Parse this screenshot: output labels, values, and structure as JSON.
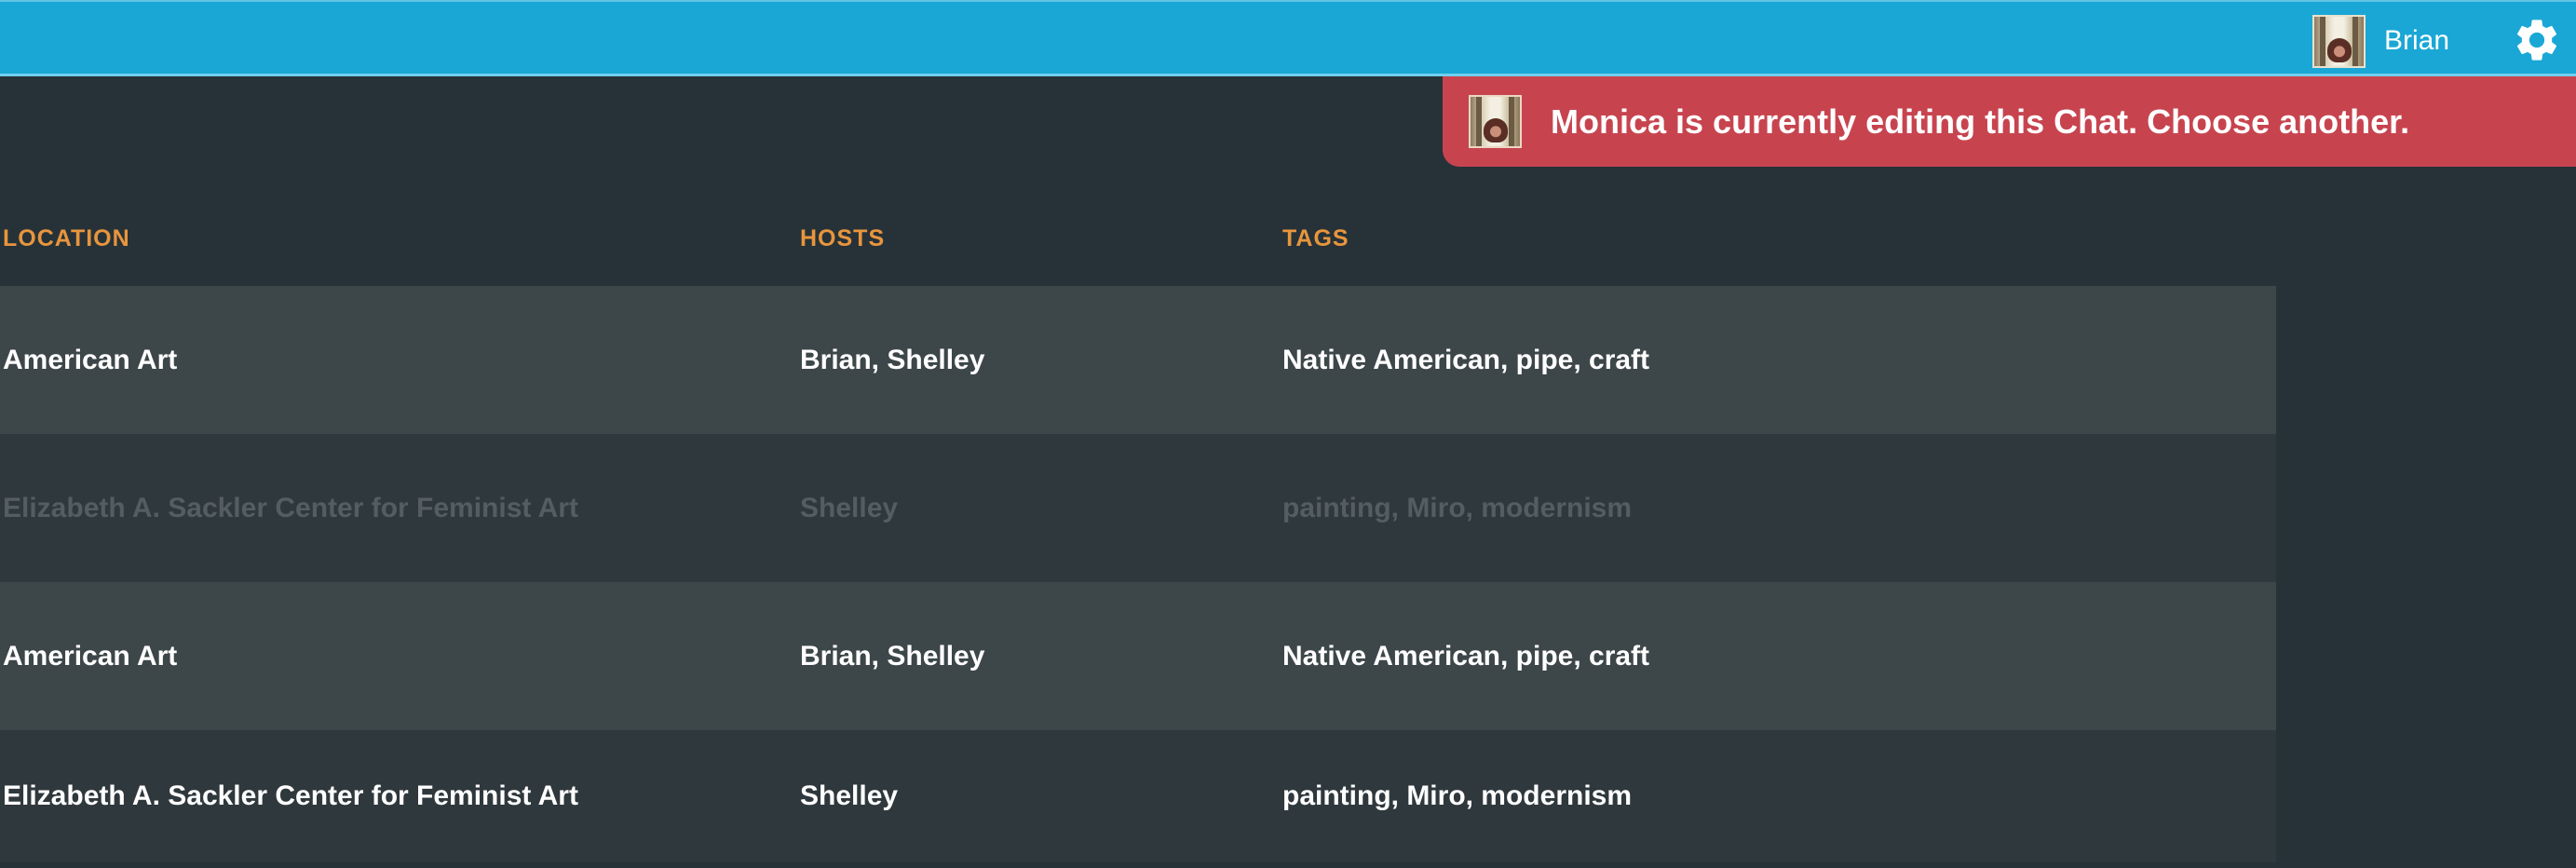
{
  "header": {
    "user_name": "Brian",
    "avatar_icon": "user-avatar-image",
    "settings_icon": "gear-icon",
    "bar_color": "#1aa7d6"
  },
  "alert": {
    "message": "Monica is currently editing this Chat. Choose another.",
    "avatar_icon": "user-avatar-image",
    "color": "#c7444f"
  },
  "table": {
    "columns": [
      "LOCATION",
      "HOSTS",
      "TAGS"
    ],
    "header_color": "#e8953d",
    "rows": [
      {
        "location": "American Art",
        "hosts": "Brian, Shelley",
        "tags": "Native American, pipe, craft",
        "disabled": false
      },
      {
        "location": "Elizabeth A. Sackler Center for Feminist Art",
        "hosts": "Shelley",
        "tags": "painting, Miro, modernism",
        "disabled": true
      },
      {
        "location": "American Art",
        "hosts": "Brian, Shelley",
        "tags": "Native American, pipe, craft",
        "disabled": false
      },
      {
        "location": "Elizabeth A. Sackler Center for Feminist Art",
        "hosts": "Shelley",
        "tags": "painting, Miro, modernism",
        "disabled": false
      }
    ]
  }
}
